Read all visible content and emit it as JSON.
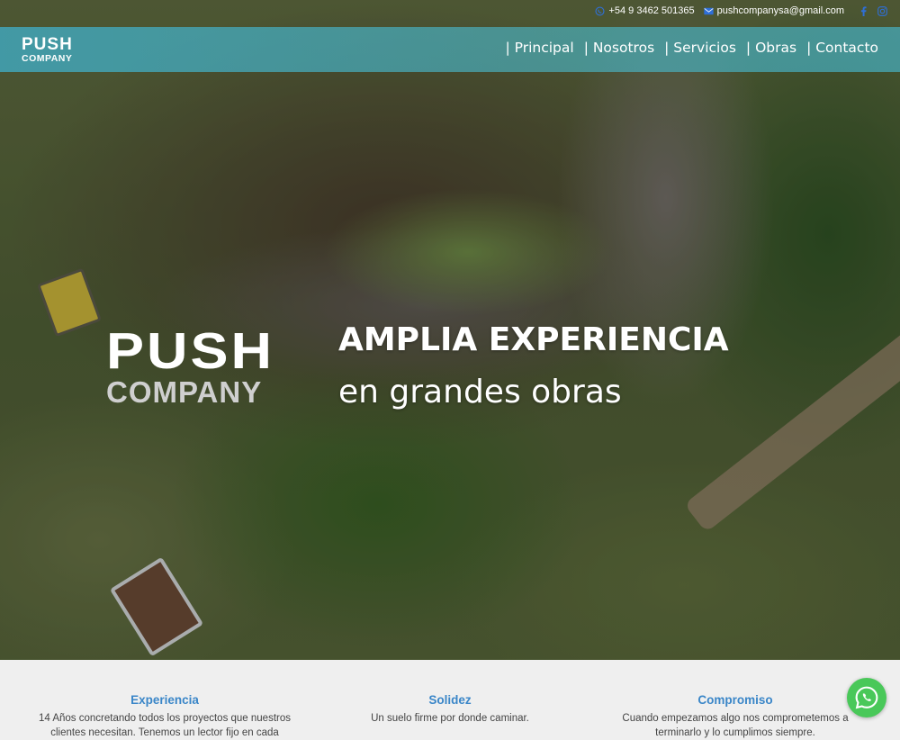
{
  "colors": {
    "nav_bar": "#46a8bb",
    "feature_title": "#3a86c8",
    "whatsapp": "#49c859",
    "features_bg": "#efefef"
  },
  "contact": {
    "phone": "+54 9 3462 501365",
    "email": "pushcompanysa@gmail.com",
    "phone_icon": "whatsapp-icon",
    "email_icon": "envelope-icon",
    "social": [
      "facebook-icon",
      "instagram-icon"
    ]
  },
  "brand": {
    "line1": "PUSH",
    "line2": "COMPANY"
  },
  "nav": {
    "items": [
      "| Principal",
      "| Nosotros",
      "| Servicios",
      "| Obras",
      "| Contacto"
    ]
  },
  "hero": {
    "logo_line1": "PUSH",
    "logo_line2": "COMPANY",
    "title": "AMPLIA EXPERIENCIA",
    "subtitle": "en grandes obras"
  },
  "features": [
    {
      "title": "Experiencia",
      "text_line1": "14 Años concretando todos los proyectos que nuestros",
      "text_line2": "clientes necesitan. Tenemos un lector fijo en cada"
    },
    {
      "title": "Solidez",
      "text_line1": "Un suelo firme por donde caminar.",
      "text_line2": ""
    },
    {
      "title": "Compromiso",
      "text_line1": "Cuando empezamos algo nos comprometemos a",
      "text_line2": "terminarlo y lo cumplimos siempre."
    }
  ],
  "whatsapp_button": {
    "icon": "whatsapp-icon"
  }
}
